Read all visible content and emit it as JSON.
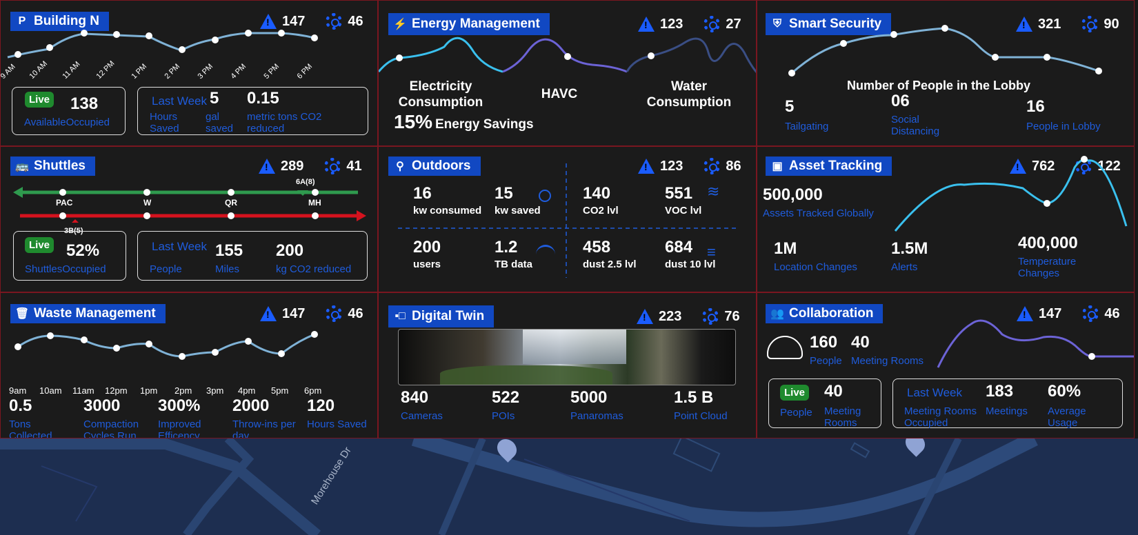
{
  "building": {
    "icon": "P",
    "title": "Building N",
    "alerts": "147",
    "settings": "46",
    "ticks": [
      "9 AM",
      "10 AM",
      "11 AM",
      "12 PM",
      "1 PM",
      "2 PM",
      "3 PM",
      "4 PM",
      "5 PM",
      "6 PM"
    ],
    "live": "Live",
    "occupied": "138",
    "occ_label": "AvailableOccupied",
    "last_week": "Last Week",
    "hours_label": "Hours\nSaved",
    "gal_val": "5",
    "gal_label": "gal\nsaved",
    "co2_val": "0.15",
    "co2_label": "metric tons CO2\nreduced"
  },
  "energy": {
    "title": "Energy Management",
    "alerts": "123",
    "settings": "27",
    "elec": "Electricity\nConsumption",
    "havc": "HAVC",
    "water": "Water\nConsumption",
    "savings_pct": "15%",
    "savings_label": "Energy Savings"
  },
  "security": {
    "title": "Smart Security",
    "alerts": "321",
    "settings": "90",
    "subtitle": "Number of People in the Lobby",
    "tail_val": "5",
    "tail_label": "Tailgating",
    "social_val": "06",
    "social_label": "Social\nDistancing",
    "lobby_val": "16",
    "lobby_label": "People in Lobby"
  },
  "shuttles": {
    "title": "Shuttles",
    "alerts": "289",
    "settings": "41",
    "stops": [
      "PAC",
      "W",
      "QR",
      "MH"
    ],
    "top_marker": "6A(8)",
    "bottom_marker": "3B(5)",
    "live": "Live",
    "occ_val": "52%",
    "occ_label": "ShuttlesOccupied",
    "last_week": "Last Week",
    "people_label": "People",
    "miles_val": "155",
    "miles_label": "Miles",
    "co2_val": "200",
    "co2_label": "kg CO2 reduced"
  },
  "outdoors": {
    "title": "Outdoors",
    "alerts": "123",
    "settings": "86",
    "items": [
      {
        "v": "16",
        "l": "kw consumed"
      },
      {
        "v": "15",
        "l": "kw saved"
      },
      {
        "v": "140",
        "l": "CO2 lvl"
      },
      {
        "v": "551",
        "l": "VOC lvl"
      },
      {
        "v": "200",
        "l": "users"
      },
      {
        "v": "1.2",
        "l": "TB data"
      },
      {
        "v": "458",
        "l": "dust 2.5 lvl"
      },
      {
        "v": "684",
        "l": "dust 10 lvl"
      }
    ]
  },
  "asset": {
    "title": "Asset Tracking",
    "alerts": "762",
    "settings": "122",
    "tracked_val": "500,000",
    "tracked_label": "Assets Tracked Globally",
    "loc_val": "1M",
    "loc_label": "Location Changes",
    "alerts_val": "1.5M",
    "alerts_label": "Alerts",
    "temp_val": "400,000",
    "temp_label": "Temperature\nChanges"
  },
  "waste": {
    "title": "Waste Management",
    "alerts": "147",
    "settings": "46",
    "ticks": [
      "9am",
      "10am",
      "11am",
      "12pm",
      "1pm",
      "2pm",
      "3pm",
      "4pm",
      "5pm",
      "6pm"
    ],
    "items": [
      {
        "v": "0.5",
        "l": "Tons\nCollected"
      },
      {
        "v": "3000",
        "l": "Compaction\nCycles Run"
      },
      {
        "v": "300%",
        "l": "Improved\nEfficency"
      },
      {
        "v": "2000",
        "l": "Throw-ins per\nday"
      },
      {
        "v": "120",
        "l": "Hours Saved"
      }
    ]
  },
  "twin": {
    "title": "Digital Twin",
    "alerts": "223",
    "settings": "76",
    "items": [
      {
        "v": "840",
        "l": "Cameras"
      },
      {
        "v": "522",
        "l": "POIs"
      },
      {
        "v": "5000",
        "l": "Panaromas"
      },
      {
        "v": "1.5 B",
        "l": "Point Cloud"
      }
    ]
  },
  "collab": {
    "title": "Collaboration",
    "alerts": "147",
    "settings": "46",
    "people_val": "160",
    "people_label": "People",
    "rooms_val": "40",
    "rooms_label": "Meeting Rooms",
    "live": "Live",
    "live_people": "People",
    "live_rooms_val": "40",
    "live_rooms_label": "Meeting\nRooms",
    "last_week": "Last Week",
    "occupied_label": "Meeting Rooms\nOccupied",
    "meetings_val": "183",
    "meetings_label": "Meetings",
    "usage_val": "60%",
    "usage_label": "Average\nUsage"
  },
  "map": {
    "street": "Morehouse Dr"
  }
}
